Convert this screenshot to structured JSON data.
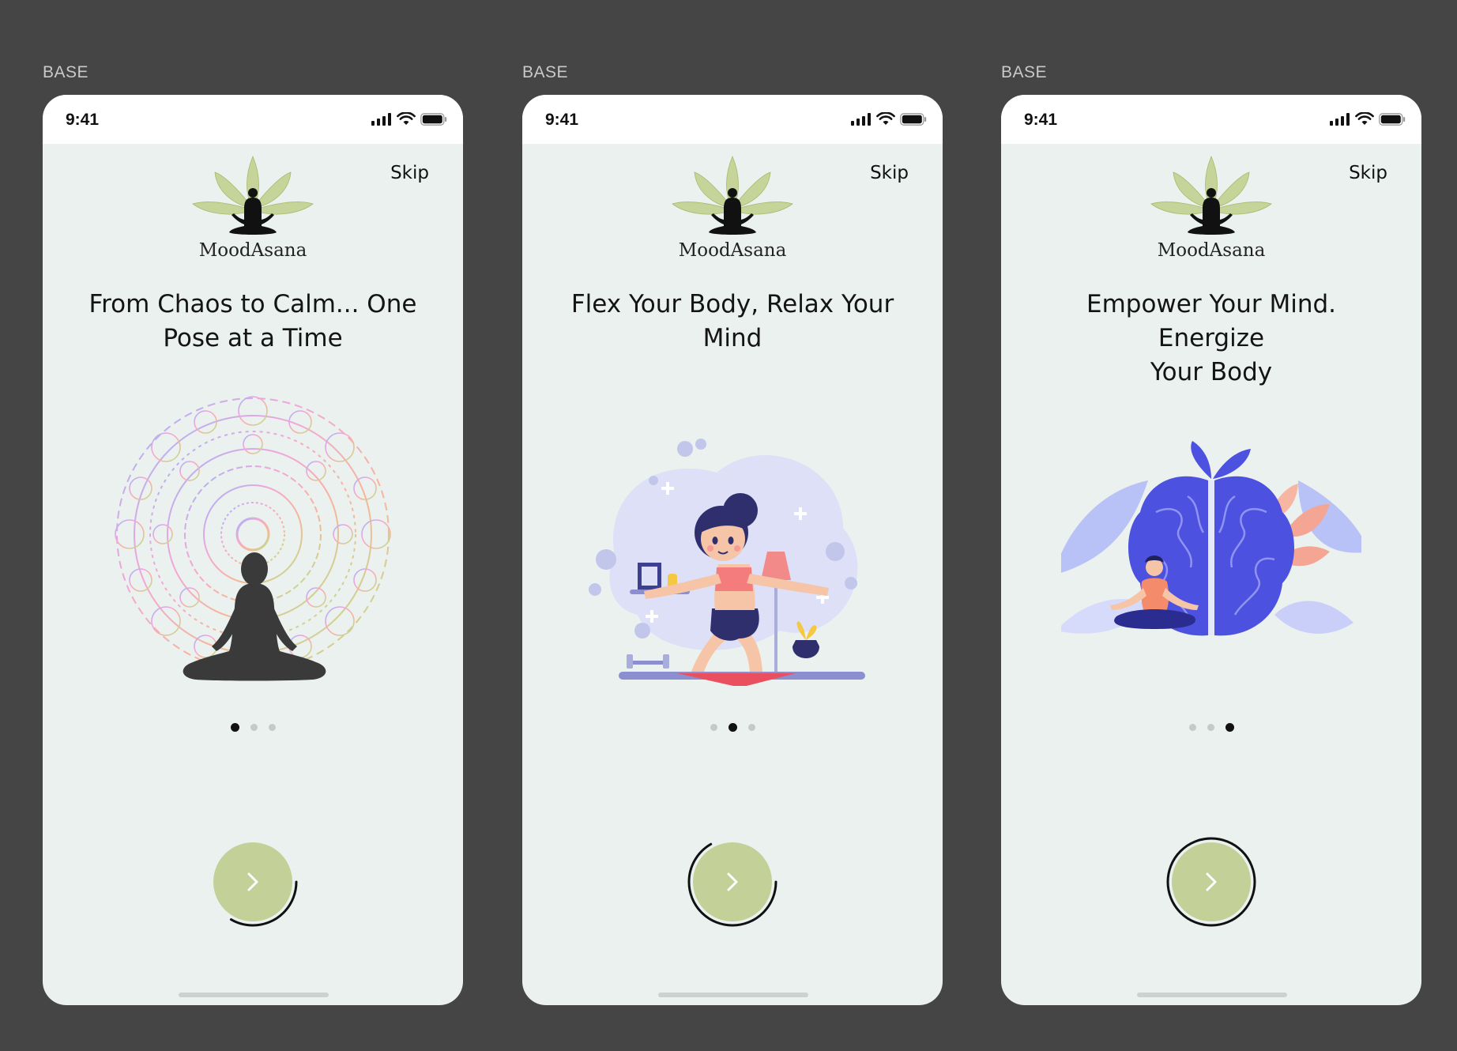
{
  "frame_label": "BASE",
  "screens": [
    {
      "time": "9:41",
      "skip_label": "Skip",
      "brand": "MoodAsana",
      "headline_line1": "From Chaos to Calm... One",
      "headline_line2": "Pose at a Time",
      "active_page": 1,
      "progress": 0.33
    },
    {
      "time": "9:41",
      "skip_label": "Skip",
      "brand": "MoodAsana",
      "headline_line1": "Flex Your Body, Relax Your",
      "headline_line2": "Mind",
      "active_page": 2,
      "progress": 0.66
    },
    {
      "time": "9:41",
      "skip_label": "Skip",
      "brand": "MoodAsana",
      "headline_line1": "Empower Your Mind. Energize",
      "headline_line2": "Your Body",
      "active_page": 3,
      "progress": 1.0
    }
  ],
  "colors": {
    "background": "#454545",
    "screen": "#eaf1ee",
    "button": "#c3d098",
    "active_dot": "#111111",
    "inactive_dot": "#c6c9c7"
  },
  "icons": [
    "signal-icon",
    "wifi-icon",
    "battery-icon",
    "chevron-right-icon",
    "yoga-lotus-logo"
  ]
}
